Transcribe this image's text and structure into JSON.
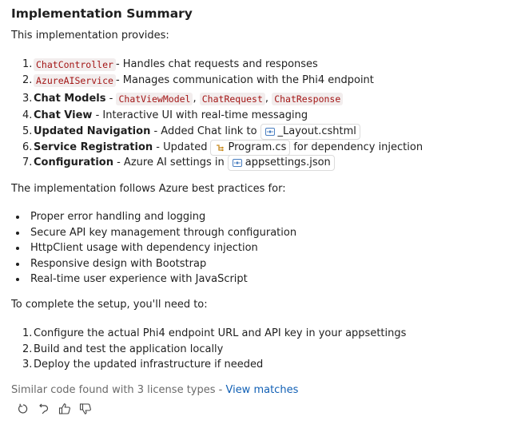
{
  "title": "Implementation Summary",
  "intro": "This implementation provides:",
  "provides": [
    {
      "n": "1.",
      "code": "ChatController",
      "rest": " - Handles chat requests and responses"
    },
    {
      "n": "2.",
      "code": "AzureAIService",
      "rest": " - Manages communication with the Phi4 endpoint"
    },
    {
      "n": "3.",
      "bold": "Chat Models",
      "sep": " - ",
      "codes": [
        "ChatViewModel",
        "ChatRequest",
        "ChatResponse"
      ]
    },
    {
      "n": "4.",
      "bold": "Chat View",
      "rest": " - Interactive UI with real-time messaging"
    },
    {
      "n": "5.",
      "bold": "Updated Navigation",
      "rest": " - Added Chat link to",
      "file": "_Layout.cshtml"
    },
    {
      "n": "6.",
      "bold": "Service Registration",
      "rest": " - Updated",
      "file": "Program.cs",
      "after": "for dependency injection"
    },
    {
      "n": "7.",
      "bold": "Configuration",
      "rest": " - Azure AI settings in",
      "file": "appsettings.json"
    }
  ],
  "practices_intro": "The implementation follows Azure best practices for:",
  "practices": [
    "Proper error handling and logging",
    "Secure API key management through configuration",
    "HttpClient usage with dependency injection",
    "Responsive design with Bootstrap",
    "Real-time user experience with JavaScript"
  ],
  "setup_intro": "To complete the setup, you'll need to:",
  "setup": [
    {
      "n": "1.",
      "text": "Configure the actual Phi4 endpoint URL and API key in your appsettings"
    },
    {
      "n": "2.",
      "text": "Build and test the application locally"
    },
    {
      "n": "3.",
      "text": "Deploy the updated infrastructure if needed"
    }
  ],
  "license_text": "Similar code found with 3 license types - ",
  "license_link": "View matches",
  "icons": {
    "retry": "retry-icon",
    "undo": "undo-icon",
    "thumbs_up": "thumbs-up-icon",
    "thumbs_down": "thumbs-down-icon"
  },
  "colors": {
    "code_text": "#a31515",
    "code_bg": "#f2eded",
    "link": "#1160b5",
    "muted": "#6b6b6b"
  }
}
